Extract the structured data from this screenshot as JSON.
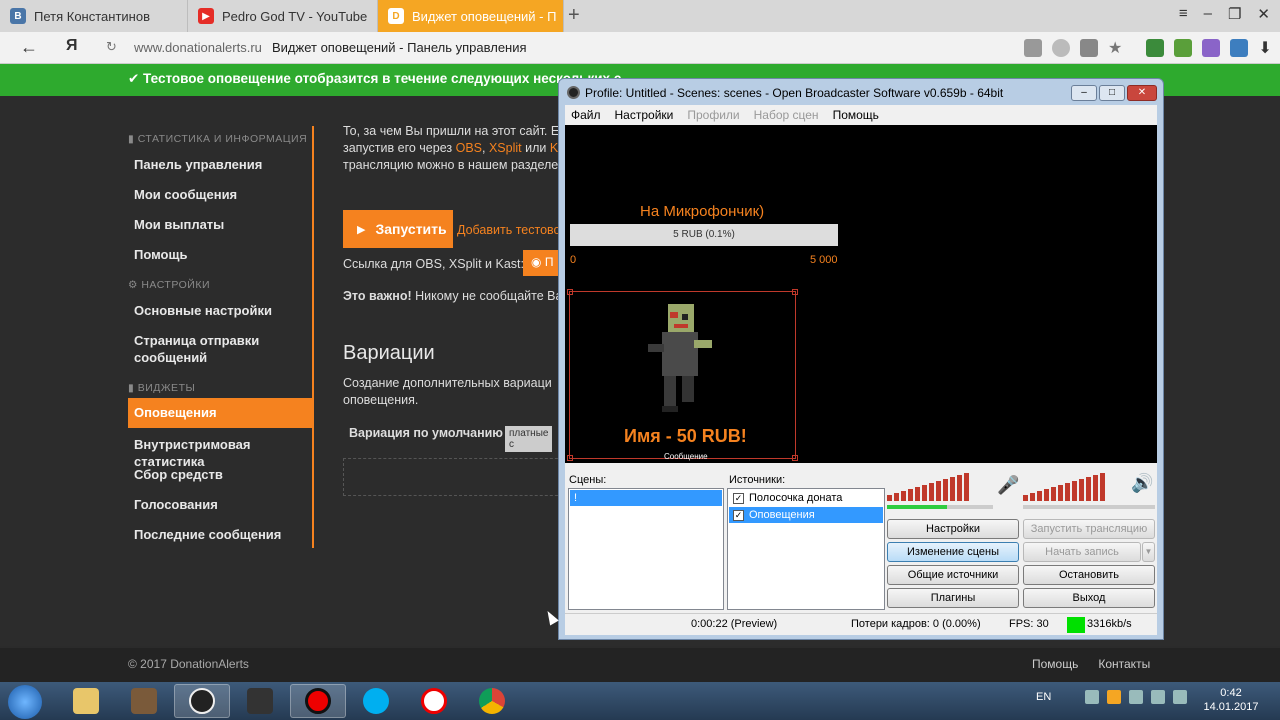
{
  "browser": {
    "tabs": [
      {
        "label": "Петя Константинов",
        "icon": "vk-icon"
      },
      {
        "label": "Pedro God TV - YouTube",
        "icon": "youtube-icon"
      },
      {
        "label": "Виджет оповещений - П",
        "icon": "donationalerts-icon"
      }
    ],
    "domain": "www.donationalerts.ru",
    "page_title": "Виджет оповещений - Панель управления"
  },
  "notification": "✔ Тестовое оповещение отобразится в течение следующих нескольких с",
  "sidebar": {
    "sections": {
      "stats": "СТАТИСТИКА И ИНФОРМАЦИЯ",
      "settings": "НАСТРОЙКИ",
      "widgets": "ВИДЖЕТЫ"
    },
    "items": [
      "Панель управления",
      "Мои сообщения",
      "Мои выплаты",
      "Помощь",
      "Основные настройки",
      "Страница отправки сообщений",
      "Оповещения",
      "Внутристримовая статистика",
      "Сбор средств",
      "Голосования",
      "Последние сообщения"
    ]
  },
  "content": {
    "line1": "То, за чем Вы пришли на этот сайт. E",
    "line2_pre": "запустив его через ",
    "line2_obs": "OBS",
    "line2_xsplit": "XSplit",
    "line2_or": " или ",
    "line2_k": "Ka",
    "line3": "трансляцию можно в нашем разделе",
    "launch_label": "Запустить",
    "add_test": "Добавить тестово",
    "obs_link_label": "Ссылка для OBS, XSplit и Kast:",
    "eye_label": "П",
    "important_bold": "Это важно!",
    "important_rest": " Никому не сообщайте Ва",
    "variations_title": "Вариации",
    "variations_desc1": "Создание дополнительных вариаци",
    "variations_desc2": "оповещения.",
    "default_variation": "Вариация по умолчанию",
    "paid_tag": "платные с"
  },
  "footer": {
    "copyright": "© 2017 DonationAlerts",
    "help": "Помощь",
    "contacts": "Контакты"
  },
  "obs": {
    "title": "Profile: Untitled - Scenes: scenes - Open Broadcaster Software v0.659b - 64bit",
    "menu": [
      "Файл",
      "Настройки",
      "Профили",
      "Набор сцен",
      "Помощь"
    ],
    "preview": {
      "mic_label": "На Микрофончик)",
      "progress_text": "5 RUB (0.1%)",
      "progress_fraction": 0.001,
      "min": "0",
      "max": "5 000",
      "alert_name": "Имя - 50 RUB!",
      "alert_msg": "Сообщение"
    },
    "scenes_label": "Сцены:",
    "scene_item": "!",
    "sources_label": "Источники:",
    "sources": [
      {
        "name": "Полосочка доната",
        "checked": true
      },
      {
        "name": "Оповещения",
        "checked": true
      }
    ],
    "buttons": {
      "settings": "Настройки",
      "start_stream": "Запустить трансляцию",
      "edit_scene": "Изменение сцены",
      "start_record": "Начать запись",
      "global_sources": "Общие источники",
      "stop_preview": "Остановить предпросмотр",
      "plugins": "Плагины",
      "exit": "Выход"
    },
    "status": {
      "time": "0:00:22 (Preview)",
      "dropped": "Потери кадров: 0 (0.00%)",
      "fps": "FPS: 30",
      "bitrate": "3316kb/s"
    }
  },
  "taskbar": {
    "lang": "EN",
    "time": "0:42",
    "date": "14.01.2017"
  }
}
